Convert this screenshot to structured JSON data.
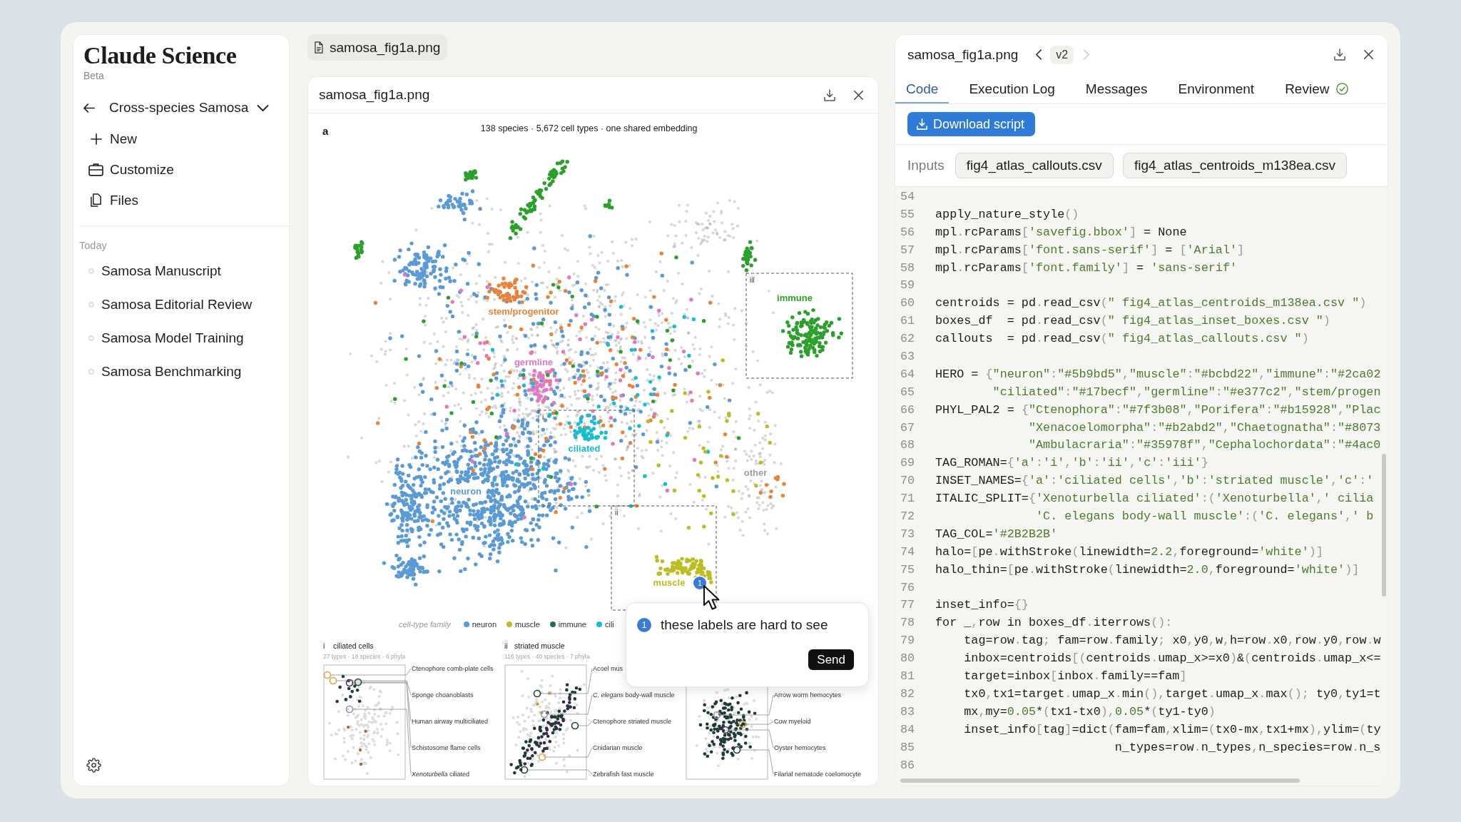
{
  "sidebar": {
    "brand": "Claude Science",
    "badge": "Beta",
    "project": "Cross-species Samosa",
    "nav": [
      {
        "kind": "new",
        "label": "New"
      },
      {
        "kind": "customize",
        "label": "Customize"
      },
      {
        "kind": "files",
        "label": "Files"
      }
    ],
    "section": "Today",
    "chats": [
      {
        "label": "Samosa Manuscript",
        "selected": false
      },
      {
        "label": "Samosa Editorial Review",
        "selected": false
      },
      {
        "label": "Samosa Model Training",
        "selected": false
      },
      {
        "label": "Samosa Benchmarking",
        "selected": false
      }
    ]
  },
  "file_tab": {
    "label": "samosa_fig1a.png"
  },
  "viewer": {
    "title": "samosa_fig1a.png",
    "figure": {
      "panel_label": "a",
      "title": "138 species · 5,672 cell types · one shared embedding",
      "clusters": [
        {
          "label": "immune",
          "color": "#2ca02c"
        },
        {
          "label": "stem/progenitor",
          "color": "#e8843a"
        },
        {
          "label": "germline",
          "color": "#e377c2"
        },
        {
          "label": "ciliated",
          "color": "#17becf"
        },
        {
          "label": "other",
          "color": "#9e9e9e"
        },
        {
          "label": "neuron",
          "color": "#5b9bd5"
        },
        {
          "label": "muscle",
          "color": "#bcbd22"
        }
      ],
      "inset_boxes": [
        {
          "tag": "iii"
        },
        {
          "tag": "i"
        },
        {
          "tag": "ii"
        }
      ],
      "legend": {
        "title": "cell-type family",
        "items": [
          {
            "label": "neuron",
            "color": "#5b9bd5"
          },
          {
            "label": "muscle",
            "color": "#bcbd22"
          },
          {
            "label": "immune",
            "color": "#2b6b55"
          },
          {
            "label": "cili",
            "color": "#17becf"
          }
        ]
      },
      "insets": [
        {
          "tag": "i",
          "title": "ciliated cells",
          "subtitle": "27 types · 18 species · 6 phyla",
          "callouts": [
            "Ctenophore comb-plate cells",
            "Sponge choanoblasts",
            "Human airway multiciliated",
            "Schistosome flame cells",
            "*Xenoturbella* ciliated"
          ]
        },
        {
          "tag": "ii",
          "title": "striated muscle",
          "subtitle": "116 types · 40 species · 7 phyla",
          "callouts": [
            "Acoel mus",
            "*C. elegans* body-wall muscle",
            "Ctenophore striated muscle",
            "Cnidarian muscle",
            "Zebrafish fast muscle"
          ]
        },
        {
          "callouts": [
            "Arrow worm hemocytes",
            "Cow myeloid",
            "Oyster hemocytes",
            "Filarial nematode coelomocyte"
          ]
        }
      ]
    },
    "marker": {
      "badge": "1"
    },
    "comment": {
      "badge": "1",
      "value": "these labels are hard to see",
      "button": "Send"
    }
  },
  "panel": {
    "title": "samosa_fig1a.png",
    "version": {
      "label": "v2",
      "previous_disabled": false,
      "next_disabled": true
    },
    "tabs": [
      {
        "label": "Code",
        "selected": true,
        "passed": false
      },
      {
        "label": "Execution Log",
        "selected": false,
        "passed": false
      },
      {
        "label": "Messages",
        "selected": false,
        "passed": false
      },
      {
        "label": "Environment",
        "selected": false,
        "passed": false
      },
      {
        "label": "Review",
        "selected": false,
        "passed": true
      }
    ],
    "download_button": "Download script",
    "inputs_label": "Inputs",
    "inputs": [
      "fig4_atlas_callouts.csv",
      "fig4_atlas_centroids_m138ea.csv"
    ],
    "code": [
      {
        "number": "54"
      },
      {
        "number": "55",
        "text": "apply_nature_style()"
      },
      {
        "number": "56",
        "text": "mpl.rcParams['savefig.bbox'] = None"
      },
      {
        "number": "57",
        "text": "mpl.rcParams['font.sans-serif'] = ['Arial']"
      },
      {
        "number": "58",
        "text": "mpl.rcParams['font.family'] = 'sans-serif'"
      },
      {
        "number": "59"
      },
      {
        "number": "60",
        "text": "centroids = pd.read_csv(\" fig4_atlas_centroids_m138ea.csv \")"
      },
      {
        "number": "61",
        "text": "boxes_df  = pd.read_csv(\" fig4_atlas_inset_boxes.csv \")"
      },
      {
        "number": "62",
        "text": "callouts  = pd.read_csv(\" fig4_atlas_callouts.csv \")"
      },
      {
        "number": "63"
      },
      {
        "number": "64",
        "text": "HERO = {\"neuron\":\"#5b9bd5\",\"muscle\":\"#bcbd22\",\"immune\":\"#2ca02"
      },
      {
        "number": "65",
        "text": "        \"ciliated\":\"#17becf\",\"germline\":\"#e377c2\",\"stem/progen"
      },
      {
        "number": "66",
        "text": "PHYL_PAL2 = {\"Ctenophora\":\"#7f3b08\",\"Porifera\":\"#b15928\",\"Plac"
      },
      {
        "number": "67",
        "text": "             \"Xenacoelomorpha\":\"#b2abd2\",\"Chaetognatha\":\"#8073"
      },
      {
        "number": "68",
        "text": "             \"Ambulacraria\":\"#35978f\",\"Cephalochordata\":\"#4ac0"
      },
      {
        "number": "69",
        "text": "TAG_ROMAN={'a':'i','b':'ii','c':'iii'}"
      },
      {
        "number": "70",
        "text": "INSET_NAMES={'a':'ciliated cells','b':'striated muscle','c':'"
      },
      {
        "number": "71",
        "text": "ITALIC_SPLIT={'Xenoturbella ciliated':('Xenoturbella',' cilia"
      },
      {
        "number": "72",
        "text": "              'C. elegans body-wall muscle':('C. elegans',' b"
      },
      {
        "number": "73",
        "text": "TAG_COL='#2B2B2B'"
      },
      {
        "number": "74",
        "text": "halo=[pe.withStroke(linewidth=2.2,foreground='white')]"
      },
      {
        "number": "75",
        "text": "halo_thin=[pe.withStroke(linewidth=2.0,foreground='white')]"
      },
      {
        "number": "76"
      },
      {
        "number": "77",
        "text": "inset_info={}"
      },
      {
        "number": "78",
        "text": "for _,row in boxes_df.iterrows():"
      },
      {
        "number": "79",
        "text": "    tag=row.tag; fam=row.family; x0,y0,w,h=row.x0,row.y0,row.w"
      },
      {
        "number": "80",
        "text": "    inbox=centroids[(centroids.umap_x>=x0)&(centroids.umap_x<="
      },
      {
        "number": "81",
        "text": "    target=inbox[inbox.family==fam]"
      },
      {
        "number": "82",
        "text": "    tx0,tx1=target.umap_x.min(),target.umap_x.max(); ty0,ty1=t"
      },
      {
        "number": "83",
        "text": "    mx,my=0.05*(tx1-tx0),0.05*(ty1-ty0)"
      },
      {
        "number": "84",
        "text": "    inset_info[tag]=dict(fam=fam,xlim=(tx0-mx,tx1+mx),ylim=(ty"
      },
      {
        "number": "85",
        "text": "                         n_types=row.n_types,n_species=row.n_s"
      },
      {
        "number": "86"
      }
    ]
  }
}
